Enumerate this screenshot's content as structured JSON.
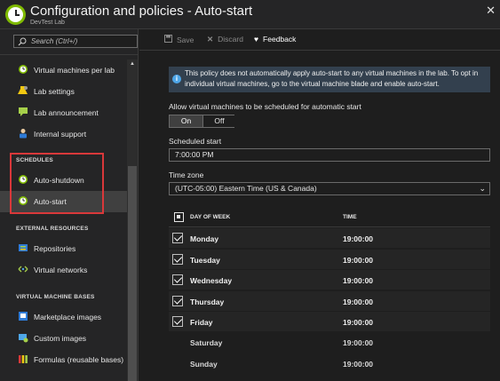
{
  "window": {
    "title": "Configuration and policies - Auto-start",
    "subtitle": "DevTest Lab",
    "close_glyph": "✕"
  },
  "sidebar": {
    "search_placeholder": "Search (Ctrl+/)",
    "items_top": [
      {
        "label": "Virtual machines per lab",
        "icon": "vm-clock-icon"
      },
      {
        "label": "Lab settings",
        "icon": "lab-settings-icon"
      },
      {
        "label": "Lab announcement",
        "icon": "announcement-icon"
      },
      {
        "label": "Internal support",
        "icon": "support-icon"
      }
    ],
    "section_schedules": "SCHEDULES",
    "schedules": [
      {
        "label": "Auto-shutdown",
        "icon": "clock-icon"
      },
      {
        "label": "Auto-start",
        "icon": "clock-icon",
        "active": true
      }
    ],
    "section_external": "EXTERNAL RESOURCES",
    "external": [
      {
        "label": "Repositories",
        "icon": "repository-icon"
      },
      {
        "label": "Virtual networks",
        "icon": "network-icon"
      }
    ],
    "section_vmbases": "VIRTUAL MACHINE BASES",
    "vmbases": [
      {
        "label": "Marketplace images",
        "icon": "marketplace-icon"
      },
      {
        "label": "Custom images",
        "icon": "custom-image-icon"
      },
      {
        "label": "Formulas (reusable bases)",
        "icon": "formula-icon"
      }
    ]
  },
  "toolbar": {
    "save_label": "Save",
    "discard_label": "Discard",
    "feedback_label": "Feedback"
  },
  "main": {
    "info_text": "This policy does not automatically apply auto-start to any virtual machines in the lab. To opt in individual virtual machines, go to the virtual machine blade and enable auto-start.",
    "allow_label": "Allow virtual machines to be scheduled for automatic start",
    "toggle_on": "On",
    "toggle_off": "Off",
    "toggle_value": "On",
    "scheduled_start_label": "Scheduled start",
    "scheduled_start_value": "7:00:00 PM",
    "timezone_label": "Time zone",
    "timezone_value": "(UTC-05:00) Eastern Time (US & Canada)",
    "grid": {
      "col_day": "DAY OF WEEK",
      "col_time": "TIME",
      "rows": [
        {
          "day": "Monday",
          "time": "19:00:00",
          "checked": true
        },
        {
          "day": "Tuesday",
          "time": "19:00:00",
          "checked": true
        },
        {
          "day": "Wednesday",
          "time": "19:00:00",
          "checked": true
        },
        {
          "day": "Thursday",
          "time": "19:00:00",
          "checked": true
        },
        {
          "day": "Friday",
          "time": "19:00:00",
          "checked": true
        },
        {
          "day": "Saturday",
          "time": "19:00:00",
          "checked": false
        },
        {
          "day": "Sunday",
          "time": "19:00:00",
          "checked": false
        }
      ]
    }
  },
  "colors": {
    "accent_green": "#7fba00",
    "info_blue": "#4ea6e8",
    "highlight_red": "#d9383a"
  }
}
